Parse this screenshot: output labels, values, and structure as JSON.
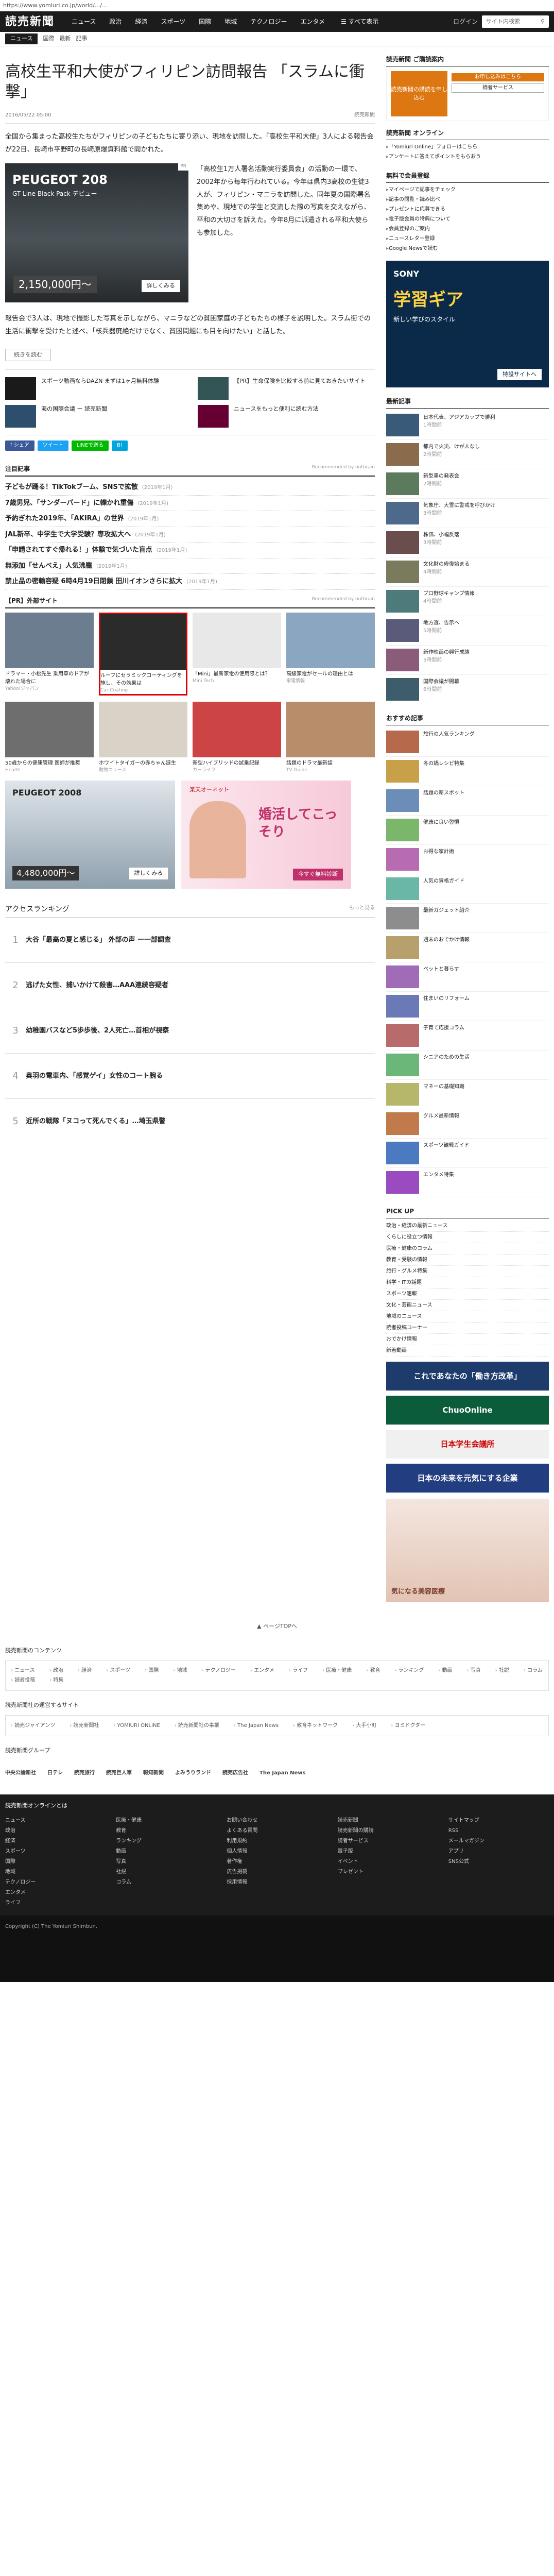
{
  "url": "https://www.yomiuri.co.jp/world/.../...",
  "header": {
    "logo": "読売新聞",
    "logo_sub": "ONLINE",
    "nav": [
      "ニュース",
      "政治",
      "経済",
      "スポーツ",
      "国際",
      "地域",
      "テクノロジー",
      "エンタメ"
    ],
    "allnews": "すべて表示",
    "login": "ログイン",
    "search_placeholder": "サイト内検索"
  },
  "subnav": {
    "category": "ニュース",
    "crumbs": [
      "国際",
      "最新",
      "記事"
    ]
  },
  "article": {
    "title": "高校生平和大使がフィリピン訪問報告 「スラムに衝撃」",
    "date": "2016/05/22 05:00",
    "byline": "読売新聞",
    "lead": "全国から集まった高校生たちがフィリピンの子どもたちに寄り添い、現地を訪問した。「高校生平和大使」3人による報告会が22日、長崎市平野町の長崎原爆資料館で開かれた。",
    "fig_text": "「高校生1万人署名活動実行委員会」の活動の一環で、2002年から毎年行われている。今年は県内3高校の生徒3人が、フィリピン・マニラを訪問した。同年夏の国際署名集めや、現地での学生と交流した際の写真を交えながら、平和の大切さを訴えた。今年8月に派遣される平和大使らも参加した。",
    "body": "報告会で3人は、現地で撮影した写真を示しながら、マニラなどの貧困家庭の子どもたちの様子を説明した。スラム街での生活に衝撃を受けたと述べ、「核兵器廃絶だけでなく、貧困問題にも目を向けたい」と話した。",
    "more": "続きを読む"
  },
  "car_ad": {
    "title": "PEUGEOT 208",
    "sub": "GT Line Black Pack デビュー",
    "price": "2,150,000円～",
    "cta": "詳しくみる",
    "label": "PR"
  },
  "promos": [
    {
      "text": "スポーツ動画ならDAZN まずは1ヶ月無料体験"
    },
    {
      "text": "【PR】生命保険を比較する前に見ておきたいサイト"
    },
    {
      "text": "海の国際会議 ー 読売新聞"
    },
    {
      "text": "ニュースをもっと便利に読む方法"
    }
  ],
  "share": [
    "f シェア",
    "ツイート",
    "LINEで送る",
    "B!"
  ],
  "recommend": {
    "title": "注目記事",
    "note": "Recommended by outbrain",
    "items": [
      {
        "text": "子どもが踊る！TikTokブーム、SNSで拡散",
        "date": "(2019年1月)"
      },
      {
        "text": "7歳男児、「サンダーバード」に轢かれ重傷",
        "date": "(2019年1月)"
      },
      {
        "text": "予約ぎれた2019年、「AKIRA」の世界",
        "date": "(2019年1月)"
      },
      {
        "text": "JAL新卒、中学生で大学受験？専攻拡大へ",
        "date": "(2019年1月)"
      },
      {
        "text": "「申請されてすぐ帰れる！」体験で気づいた盲点",
        "date": "(2019年1月)"
      },
      {
        "text": "無添加「せんべえ」人気沸騰",
        "date": "(2019年1月)"
      },
      {
        "text": "禁止品の密輸容疑 6時4月19日閉鎖 田川イオンさらに拡大",
        "date": "(2019年1月)"
      }
    ]
  },
  "pr_ads": {
    "title": "【PR】外部サイト",
    "note": "Recommended by outbrain",
    "items": [
      {
        "text": "ドラマー・小松先生 乗用車のドアが壊れた場合に",
        "src": "Yahoo!ジャパン",
        "color": "#6b7d8f"
      },
      {
        "text": "ルーフにセラミックコーティングを施し、その効果は",
        "src": "Car Coating",
        "color": "#2b2b2b"
      },
      {
        "text": "「Mini」最新家電の使用感とは？",
        "src": "Mini Tech",
        "color": "#e8e8e8"
      },
      {
        "text": "高級家電がセールの理由とは",
        "src": "家電情報",
        "color": "#8aa6c1"
      },
      {
        "text": "50歳からの健康管理 医師が推奨",
        "src": "Health",
        "color": "#6e6e6e"
      },
      {
        "text": "ホワイトタイガーの赤ちゃん誕生",
        "src": "動物ニュース",
        "color": "#d9d3c7"
      },
      {
        "text": "新型ハイブリッドの試乗記録",
        "src": "カーライフ",
        "color": "#c44"
      },
      {
        "text": "話題のドラマ最新話",
        "src": "TV Guide",
        "color": "#b78d6a"
      }
    ]
  },
  "big_ads": [
    {
      "title": "PEUGEOT 2008",
      "price": "4,480,000円～",
      "cta": "詳しくみる"
    },
    {
      "title": "婚活してこっそり",
      "sub": "楽天オーネット",
      "cta": "今すぐ無料診断"
    }
  ],
  "ranking": {
    "title": "アクセスランキング",
    "more": "もっと見る",
    "items": [
      {
        "num": "1",
        "text": "大谷「最高の夏と感じる」 外部の声 ー一部調査"
      },
      {
        "num": "2",
        "text": "逃げた女性、捕いかけて殺害…AAA連続容疑者"
      },
      {
        "num": "3",
        "text": "幼稚園バスなど5歩歩後、2人死亡…首相が視察"
      },
      {
        "num": "4",
        "text": "奥羽の電車内、「感覚ゲイ」女性のコート腕る"
      },
      {
        "num": "5",
        "text": "近所の戦隊「ヌコって死んでくる」…埼玉県警"
      }
    ]
  },
  "side": {
    "ad_title": "読売新聞 ご購読案内",
    "ad_left": "読売新聞の購読を申し込む",
    "ad_pill1": "お申し込みはこちら",
    "ad_pill2": "読者サービス",
    "box1": {
      "title": "読売新聞 オンライン",
      "items": [
        "「Yomiuri Online」フォローはこちら",
        "アンケートに答えてポイントをもらおう"
      ]
    },
    "box2": {
      "title": "無料で会員登録",
      "items": [
        "マイページで記事をチェック",
        "記事の閲覧・読み比べ",
        "プレゼントに応募できる",
        "電子版会員の特典について",
        "会員登録のご案内",
        "ニュースレター登録",
        "Google Newsで読む"
      ]
    },
    "sony": {
      "brand": "SONY",
      "big": "学習ギア",
      "sub": "新しい学びのスタイル",
      "note": "特設サイトへ"
    },
    "latest_title": "最新記事",
    "latest": [
      {
        "text": "日本代表、アジアカップで勝利",
        "time": "1時間前",
        "color": "#3a5a7a"
      },
      {
        "text": "都内で火災、けが人なし",
        "time": "2時間前",
        "color": "#8a6c4d"
      },
      {
        "text": "新型車の発表会",
        "time": "2時間前",
        "color": "#5c7a5c"
      },
      {
        "text": "気象庁、大雪に警戒を呼びかけ",
        "time": "3時間前",
        "color": "#4d6a8a"
      },
      {
        "text": "株価、小幅反落",
        "time": "3時間前",
        "color": "#6a4d4d"
      },
      {
        "text": "文化財の修復始まる",
        "time": "4時間前",
        "color": "#7a7a5c"
      },
      {
        "text": "プロ野球キャンプ情報",
        "time": "4時間前",
        "color": "#4d7a7a"
      },
      {
        "text": "地方選、告示へ",
        "time": "5時間前",
        "color": "#5a5a7a"
      },
      {
        "text": "新作映画の興行成績",
        "time": "5時間前",
        "color": "#8a5c7a"
      },
      {
        "text": "国際会議が開幕",
        "time": "6時間前",
        "color": "#3d5d6d"
      }
    ],
    "osusume_title": "おすすめ記事",
    "osusume": [
      {
        "text": "旅行の人気ランキング",
        "time": "",
        "color": "#b76a4b"
      },
      {
        "text": "冬の鍋レシピ特集",
        "time": "",
        "color": "#c9a04a"
      },
      {
        "text": "話題の新スポット",
        "time": "",
        "color": "#6b8db7"
      },
      {
        "text": "健康に良い習慣",
        "time": "",
        "color": "#7ab76b"
      },
      {
        "text": "お得な家計術",
        "time": "",
        "color": "#b76bb0"
      },
      {
        "text": "人気の資格ガイド",
        "time": "",
        "color": "#6bb7a6"
      },
      {
        "text": "最新ガジェット紹介",
        "time": "",
        "color": "#8d8d8d"
      },
      {
        "text": "週末のおでかけ情報",
        "time": "",
        "color": "#b7a06b"
      },
      {
        "text": "ペットと暮らす",
        "time": "",
        "color": "#a06bb7"
      },
      {
        "text": "住まいのリフォーム",
        "time": "",
        "color": "#6b7ab7"
      },
      {
        "text": "子育て応援コラム",
        "time": "",
        "color": "#b76b6b"
      },
      {
        "text": "シニアのための生活",
        "time": "",
        "color": "#6bb77a"
      },
      {
        "text": "マネーの基礎知識",
        "time": "",
        "color": "#b7b76b"
      },
      {
        "text": "グルメ最新情報",
        "time": "",
        "color": "#c07a4b"
      },
      {
        "text": "スポーツ観戦ガイド",
        "time": "",
        "color": "#4b7ac0"
      },
      {
        "text": "エンタメ特集",
        "time": "",
        "color": "#9a4bc0"
      }
    ],
    "pickup_title": "PICK UP",
    "pickup": [
      "政治・経済の最新ニュース",
      "くらしに役立つ情報",
      "医療・健康のコラム",
      "教育・受験の情報",
      "旅行・グルメ特集",
      "科学・ITの話題",
      "スポーツ速報",
      "文化・芸能ニュース",
      "地域のニュース",
      "読者投稿コーナー",
      "おでかけ情報",
      "新着動画"
    ],
    "banners": [
      {
        "text": "これであなたの「働き方改革」",
        "color": "#1d3b6b",
        "fg": "#fff"
      },
      {
        "text": "ChuoOnline",
        "color": "#0a5c3a",
        "fg": "#fff"
      },
      {
        "text": "日本学生会議所",
        "color": "#f0f0f0",
        "fg": "#c00"
      },
      {
        "text": "日本の未来を元気にする企業",
        "color": "#233e80",
        "fg": "#fff"
      }
    ],
    "bottom_ad": "気になる美容医療"
  },
  "pagetop": "ページTOPへ",
  "footer": {
    "more_title": "読売新聞のコンテンツ",
    "links1": [
      "ニュース",
      "政治",
      "経済",
      "スポーツ",
      "国際",
      "地域",
      "テクノロジー",
      "エンタメ",
      "ライフ",
      "医療・健康",
      "教育",
      "ランキング",
      "動画",
      "写真",
      "社説",
      "コラム",
      "読者投稿",
      "特集"
    ],
    "related_title": "読売新聞社の運営するサイト",
    "links2": [
      "読売ジャイアンツ",
      "読売新聞社",
      "YOMIURI ONLINE",
      "読売新聞社の事業",
      "The Japan News",
      "教育ネットワーク",
      "大手小町",
      "ヨミドクター"
    ],
    "partners_title": "読売新聞グループ",
    "partners": [
      "中央公論新社",
      "日テレ",
      "読売旅行",
      "読売巨人軍",
      "報知新聞",
      "よみうりランド",
      "読売広告社",
      "The Japan News"
    ],
    "dark_head": "読売新聞オンラインとは",
    "dark_cols": [
      [
        "ニュース",
        "政治",
        "経済",
        "スポーツ",
        "国際",
        "地域",
        "テクノロジー",
        "エンタメ",
        "ライフ"
      ],
      [
        "医療・健康",
        "教育",
        "ランキング",
        "動画",
        "写真",
        "社説",
        "コラム"
      ],
      [
        "お問い合わせ",
        "よくある質問",
        "利用規約",
        "個人情報",
        "著作権",
        "広告掲載",
        "採用情報"
      ],
      [
        "読売新聞",
        "読売新聞の購読",
        "読者サービス",
        "電子版",
        "イベント",
        "プレゼント"
      ],
      [
        "サイトマップ",
        "RSS",
        "メールマガジン",
        "アプリ",
        "SNS公式"
      ]
    ],
    "copyright": "Copyright (C) The Yomiuri Shimbun."
  }
}
